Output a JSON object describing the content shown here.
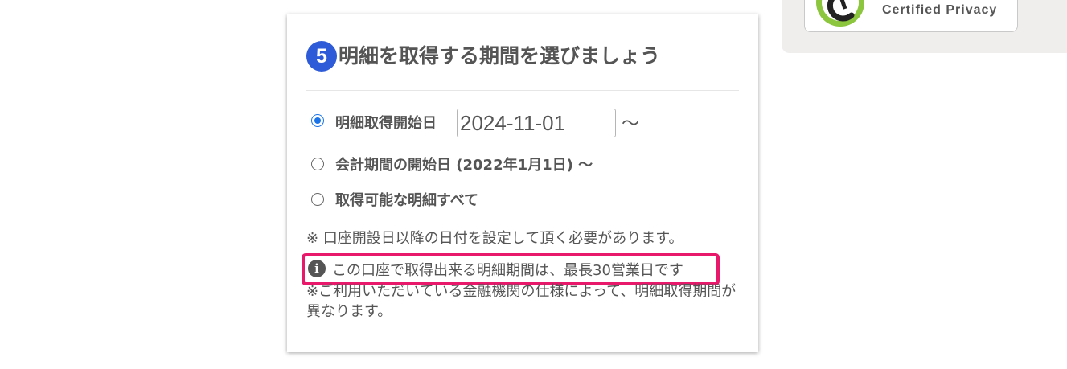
{
  "privacy_badge": {
    "text": "Certified Privacy",
    "colors": {
      "green": "#8cc63f",
      "dark": "#222222"
    },
    "logo_icon": "certified-privacy-logo"
  },
  "step": {
    "number": "5",
    "title": "明細を取得する期間を選びましょう",
    "accent_color": "#2e5bd8"
  },
  "options": [
    {
      "label": "明細取得開始日",
      "checked": true,
      "date_value": "2024-11-01",
      "suffix": "〜"
    },
    {
      "label": "会計期間の開始日 (2022年1月1日) 〜",
      "checked": false
    },
    {
      "label": "取得可能な明細すべて",
      "checked": false
    }
  ],
  "note": "※ 口座開設日以降の日付を設定して頂く必要があります。",
  "info": {
    "icon": "info-icon",
    "text": "この口座で取得出来る明細期間は、最長30営業日です",
    "highlight_color": "#e8196a"
  },
  "subnote": "※ご利用いただいている金融機関の仕様によって、明細取得期間が異なります。"
}
